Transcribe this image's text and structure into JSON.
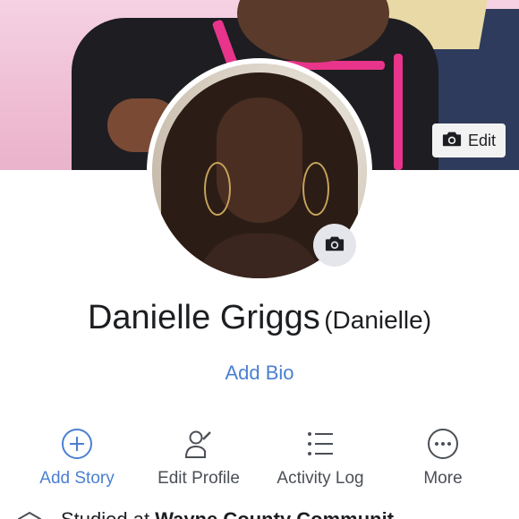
{
  "cover": {
    "edit_label": "Edit",
    "edit_icon": "camera-icon"
  },
  "profile": {
    "name": "Danielle Griggs",
    "alternate_name": "(Danielle)",
    "avatar_camera_icon": "camera-icon",
    "add_bio": "Add Bio"
  },
  "actions": [
    {
      "label": "Add Story",
      "icon": "plus-circle-icon",
      "color": "#4a7fd1"
    },
    {
      "label": "Edit Profile",
      "icon": "edit-person-icon",
      "color": "#4b4f56"
    },
    {
      "label": "Activity Log",
      "icon": "list-icon",
      "color": "#4b4f56"
    },
    {
      "label": "More",
      "icon": "more-dots-icon",
      "color": "#4b4f56"
    }
  ],
  "intro": {
    "studied_prefix": "Studied at",
    "school": "Wayne County Communit"
  },
  "colors": {
    "link_blue": "#4a7fd1",
    "text_dark": "#1c1e21",
    "text_gray": "#4b4f56"
  }
}
